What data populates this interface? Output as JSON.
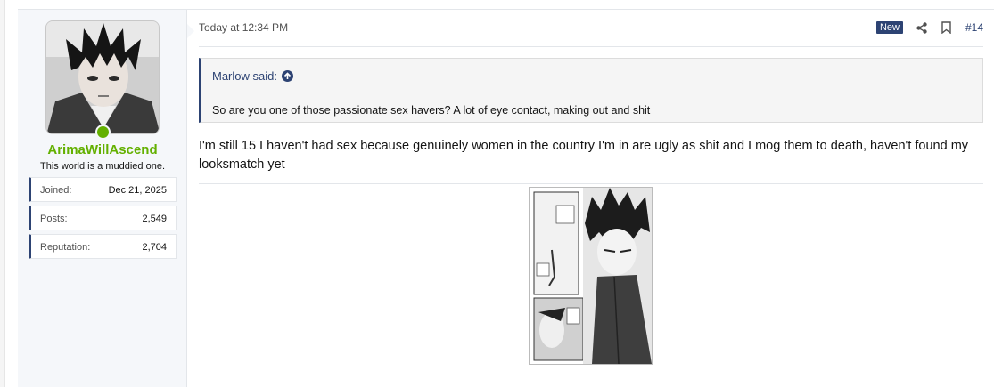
{
  "post": {
    "timestamp": "Today at 12:34 PM",
    "new_badge": "New",
    "post_number": "#14"
  },
  "user": {
    "name": "ArimaWillAscend",
    "title": "This world is a muddied one.",
    "stats": [
      {
        "label": "Joined:",
        "value": "Dec 21, 2025"
      },
      {
        "label": "Posts:",
        "value": "2,549"
      },
      {
        "label": "Reputation:",
        "value": "2,704"
      }
    ],
    "online": true
  },
  "quote": {
    "author": "Marlow said:",
    "text": "So are you one of those passionate sex havers? A lot of eye contact, making out and shit"
  },
  "message": {
    "text": "I'm still 15 I haven't had sex because genuinely women in the country I'm in are ugly as shit and I mog them to death, haven't found my looksmatch yet"
  },
  "icons": {
    "share": "share-icon",
    "bookmark": "bookmark-icon",
    "quote_up": "arrow-up-icon"
  },
  "colors": {
    "accent": "#2d4373",
    "username": "#63b000",
    "online": "#63b000"
  }
}
